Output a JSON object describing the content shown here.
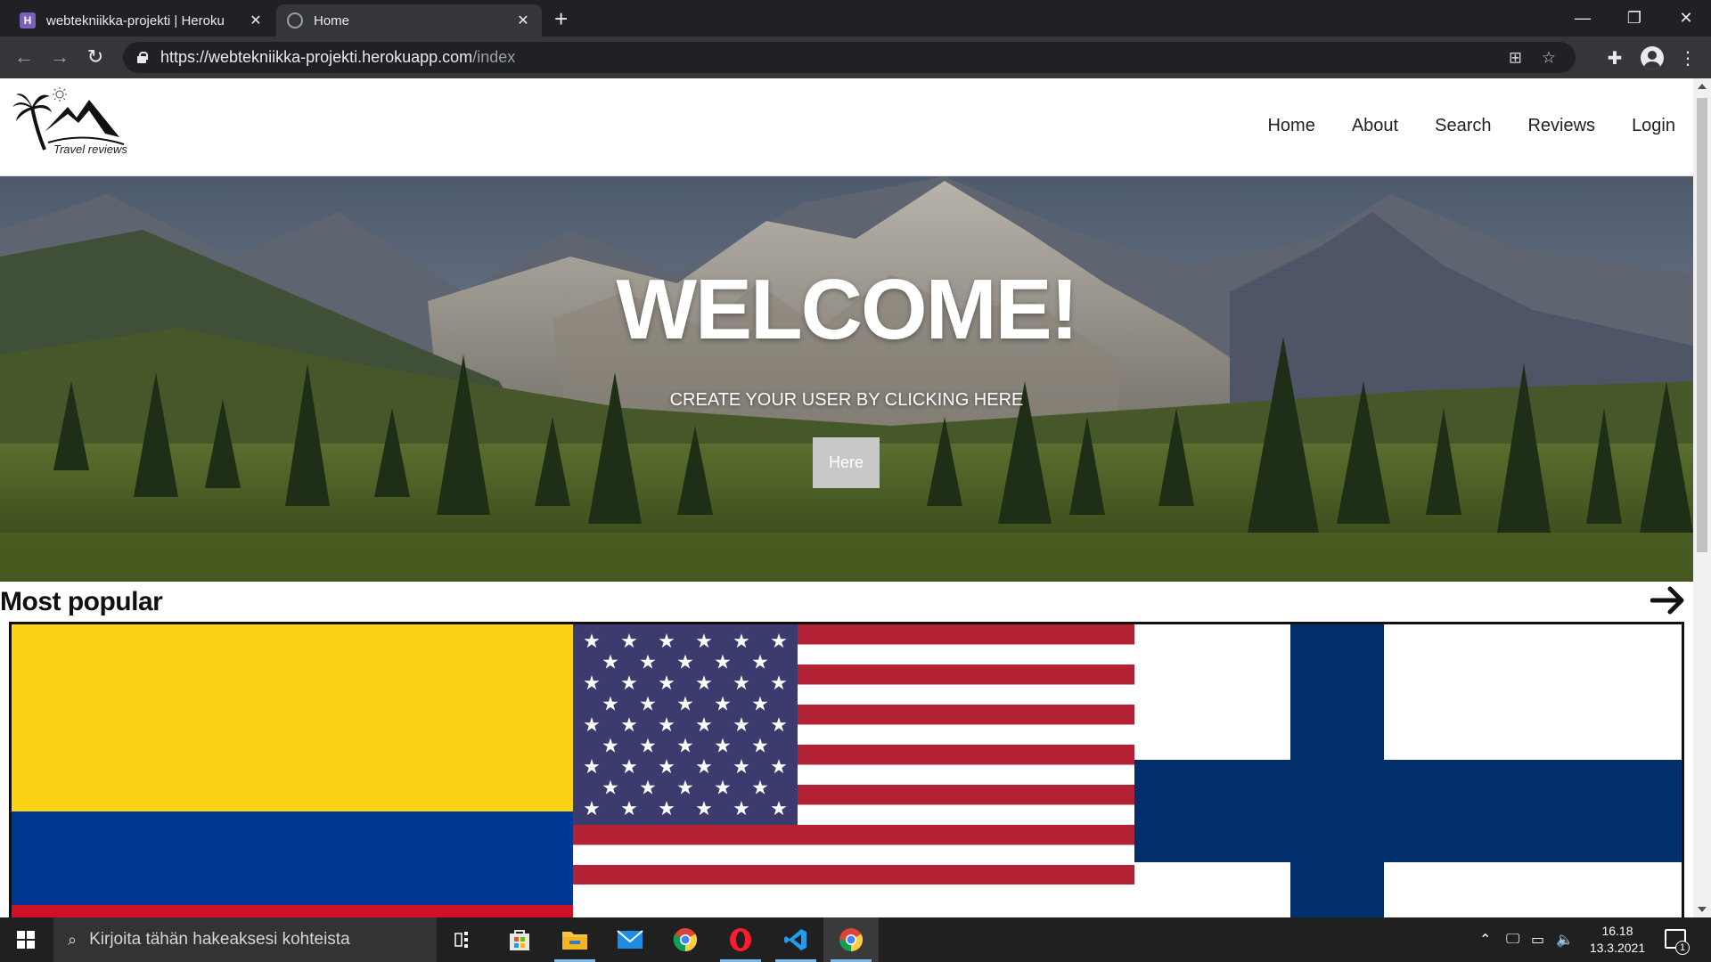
{
  "browser": {
    "tabs": [
      {
        "title": "webtekniikka-projekti | Heroku",
        "favicon": "heroku-icon",
        "active": false
      },
      {
        "title": "Home",
        "favicon": "globe-icon",
        "active": true
      }
    ],
    "url_host": "https://webtekniikka-projekti.herokuapp.com",
    "url_path": "/index"
  },
  "site": {
    "logo_text": "Travel reviews",
    "nav": [
      "Home",
      "About",
      "Search",
      "Reviews",
      "Login"
    ]
  },
  "hero": {
    "title": "WELCOME!",
    "subtitle": "CREATE YOUR USER BY CLICKING HERE",
    "button": "Here"
  },
  "popular": {
    "title": "Most popular",
    "flags": [
      "colombia-flag",
      "usa-flag",
      "finland-flag"
    ]
  },
  "taskbar": {
    "search_placeholder": "Kirjoita tähän hakeaksesi kohteista",
    "time": "16.18",
    "date": "13.3.2021",
    "notifications": "1"
  },
  "colors": {
    "chrome_dark": "#202124",
    "chrome_toolbar": "#35363a",
    "colombia_yellow": "#fcd116",
    "colombia_blue": "#003893",
    "colombia_red": "#ce1126",
    "usa_red": "#b22234",
    "usa_blue": "#3c3b6e",
    "finland_blue": "#002f6c"
  }
}
